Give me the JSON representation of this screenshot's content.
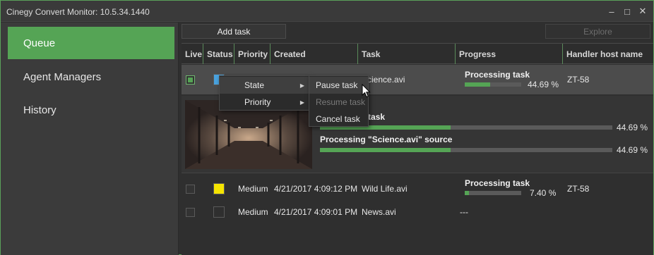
{
  "window": {
    "title": "Cinegy Convert Monitor: 10.5.34.1440"
  },
  "sidebar": {
    "items": [
      {
        "label": "Queue",
        "active": true
      },
      {
        "label": "Agent Managers",
        "active": false
      },
      {
        "label": "History",
        "active": false
      }
    ]
  },
  "toolbar": {
    "add_task_label": "Add task",
    "explore_label": "Explore"
  },
  "columns": [
    "Live",
    "Status",
    "Priority",
    "Created",
    "Task",
    "Progress",
    "Handler host name"
  ],
  "rows": [
    {
      "live": true,
      "status_color": "#4aa3df",
      "priority": "",
      "created": "",
      "task": "Science.avi",
      "progress_title": "Processing task",
      "progress": 0.4469,
      "percent": "44.69 %",
      "handler": "ZT-58",
      "details": [
        {
          "title": "Processing task",
          "progress": 0.4469,
          "percent": "44.69 %"
        },
        {
          "title": "Processing \"Science.avi\" source",
          "progress": 0.4469,
          "percent": "44.69 %"
        }
      ]
    },
    {
      "live": false,
      "status_color": "#f5e400",
      "priority": "Medium",
      "created": "4/21/2017 4:09:12 PM",
      "task": "Wild Life.avi",
      "progress_title": "Processing task",
      "progress": 0.074,
      "percent": "7.40 %",
      "handler": "ZT-58"
    },
    {
      "live": false,
      "status_color": "#2f2f2f",
      "priority": "Medium",
      "created": "4/21/2017 4:09:01 PM",
      "task": "News.avi",
      "progress_text": "---",
      "handler": ""
    }
  ],
  "context_menu": {
    "items": [
      {
        "label": "State"
      },
      {
        "label": "Priority"
      }
    ]
  },
  "submenu": {
    "items": [
      {
        "label": "Pause task",
        "enabled": true
      },
      {
        "label": "Resume task",
        "enabled": false
      },
      {
        "label": "Cancel task",
        "enabled": true
      }
    ]
  },
  "colors": {
    "accent": "#55a455",
    "background": "#2f2f2f",
    "sidebar": "#3b3b3b"
  },
  "icons": [
    "minimize-icon",
    "maximize-icon",
    "close-icon",
    "submenu-arrow-icon",
    "mouse-cursor-icon"
  ]
}
